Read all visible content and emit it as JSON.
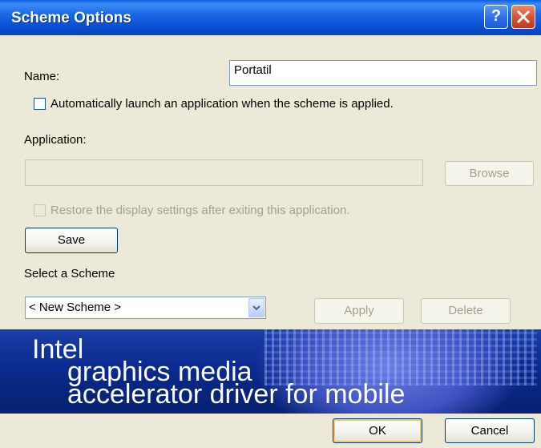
{
  "window": {
    "title": "Scheme Options"
  },
  "name_field": {
    "label": "Name:",
    "value": "Portatil"
  },
  "auto_launch": {
    "label": "Automatically launch an application when the scheme is applied.",
    "checked": false
  },
  "application": {
    "label": "Application:",
    "value": "",
    "browse_label": "Browse"
  },
  "restore": {
    "label": "Restore the display settings after exiting this application.",
    "checked": false
  },
  "save_label": "Save",
  "scheme": {
    "label": "Select a Scheme",
    "selected": "< New Scheme >",
    "apply_label": "Apply",
    "delete_label": "Delete"
  },
  "banner": {
    "line1": "Intel",
    "line2": "graphics media",
    "line3": "accelerator driver for mobile"
  },
  "footer": {
    "ok_label": "OK",
    "cancel_label": "Cancel"
  },
  "colors": {
    "titlebar": "#0b4fd3",
    "dialog_bg": "#ece9d8",
    "banner": "#0a2a8e",
    "close_button": "#d7502f"
  }
}
